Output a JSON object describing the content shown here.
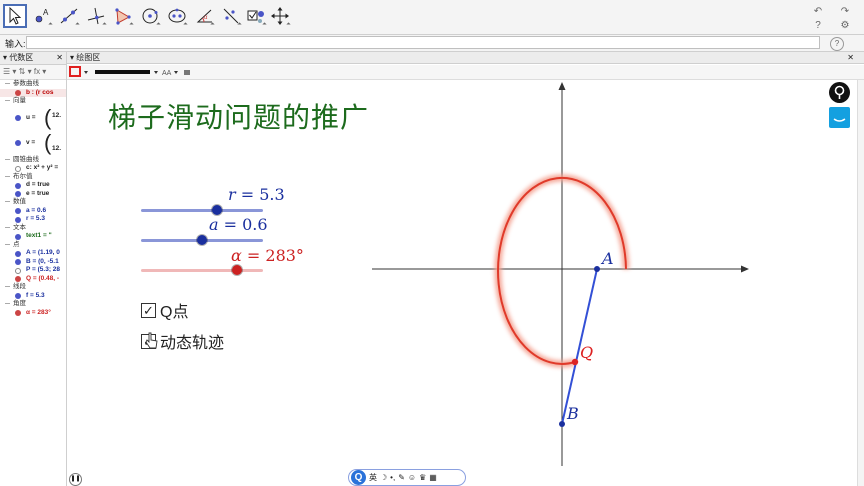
{
  "input_bar": {
    "label": "输入:",
    "value": ""
  },
  "algebra": {
    "title": "代数区",
    "sections": [
      {
        "cat": "参数曲线",
        "items": [
          {
            "text": "b : (r cos",
            "style": "selected"
          }
        ]
      },
      {
        "cat": "向量",
        "vectors": [
          {
            "text": "u =",
            "val": "12."
          },
          {
            "text": "v =",
            "val": "12."
          }
        ]
      },
      {
        "cat": "圆锥曲线",
        "items": [
          {
            "text": "c: x² + y² =",
            "style": "hollow"
          }
        ]
      },
      {
        "cat": "布尔值",
        "items": [
          {
            "text": "d = true"
          },
          {
            "text": "e = true"
          }
        ]
      },
      {
        "cat": "数值",
        "items": [
          {
            "text": "a = 0.6"
          },
          {
            "text": "r = 5.3"
          }
        ]
      },
      {
        "cat": "文本",
        "items": [
          {
            "text": "text1 = \"",
            "style": "green"
          }
        ]
      },
      {
        "cat": "点",
        "items": [
          {
            "text": "A = (1.19, 0"
          },
          {
            "text": "B = (0, -5.1"
          },
          {
            "text": "P = (5.3; 28",
            "style": "hollow"
          },
          {
            "text": "Q = (0.48, -",
            "style": "red"
          }
        ]
      },
      {
        "cat": "线段",
        "items": [
          {
            "text": "f = 5.3"
          }
        ]
      },
      {
        "cat": "角度",
        "items": [
          {
            "text": "α = 283°",
            "style": "redtext"
          }
        ]
      }
    ]
  },
  "graphics": {
    "title": "绘图区",
    "heading": "梯子滑动问题的推广",
    "sliders": [
      {
        "name": "r",
        "value": "5.3",
        "fraction": 0.62,
        "color": "#1a2f9e",
        "track": "#8a96d8"
      },
      {
        "name": "a",
        "value": "0.6",
        "fraction": 0.5,
        "color": "#1a2f9e",
        "track": "#8a96d8"
      },
      {
        "name": "α",
        "value": "283°",
        "fraction": 0.79,
        "color": "#cc2222",
        "track": "#f0b8b8"
      }
    ],
    "checkboxes": [
      {
        "label": "Q点",
        "checked": true
      },
      {
        "label": "动态轨迹",
        "checked": true
      }
    ],
    "points": {
      "A": "A",
      "B": "B",
      "Q": "Q"
    },
    "colors": {
      "curve": "#e03a2a",
      "segment": "#3350d6",
      "title": "#1d6b1d"
    }
  },
  "bottom_bar": {
    "lang": "英"
  }
}
